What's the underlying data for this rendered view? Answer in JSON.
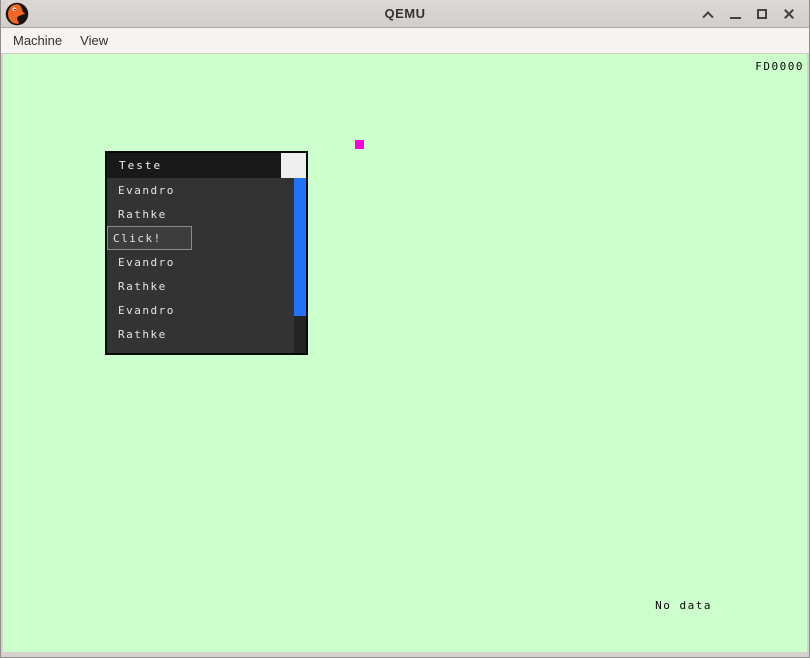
{
  "window": {
    "title": "QEMU"
  },
  "menu_bar": {
    "items": [
      "Machine",
      "View"
    ]
  },
  "screen": {
    "bg_color": "#ccffcc",
    "top_right_label": "FD0000",
    "bottom_right_label": "No data",
    "cursor_color": "#ff00dd"
  },
  "teste_window": {
    "title": "Teste",
    "items": [
      {
        "type": "label",
        "label": "Evandro"
      },
      {
        "type": "label",
        "label": "Rathke"
      },
      {
        "type": "button",
        "label": "Click!"
      },
      {
        "type": "label",
        "label": "Evandro"
      },
      {
        "type": "label",
        "label": "Rathke"
      },
      {
        "type": "label",
        "label": "Evandro"
      },
      {
        "type": "label",
        "label": "Rathke"
      }
    ],
    "colors": {
      "titlebar": "#191919",
      "body": "#333333",
      "scrollbar_thumb": "#2273fc",
      "scrollbar_track": "#242424"
    }
  }
}
